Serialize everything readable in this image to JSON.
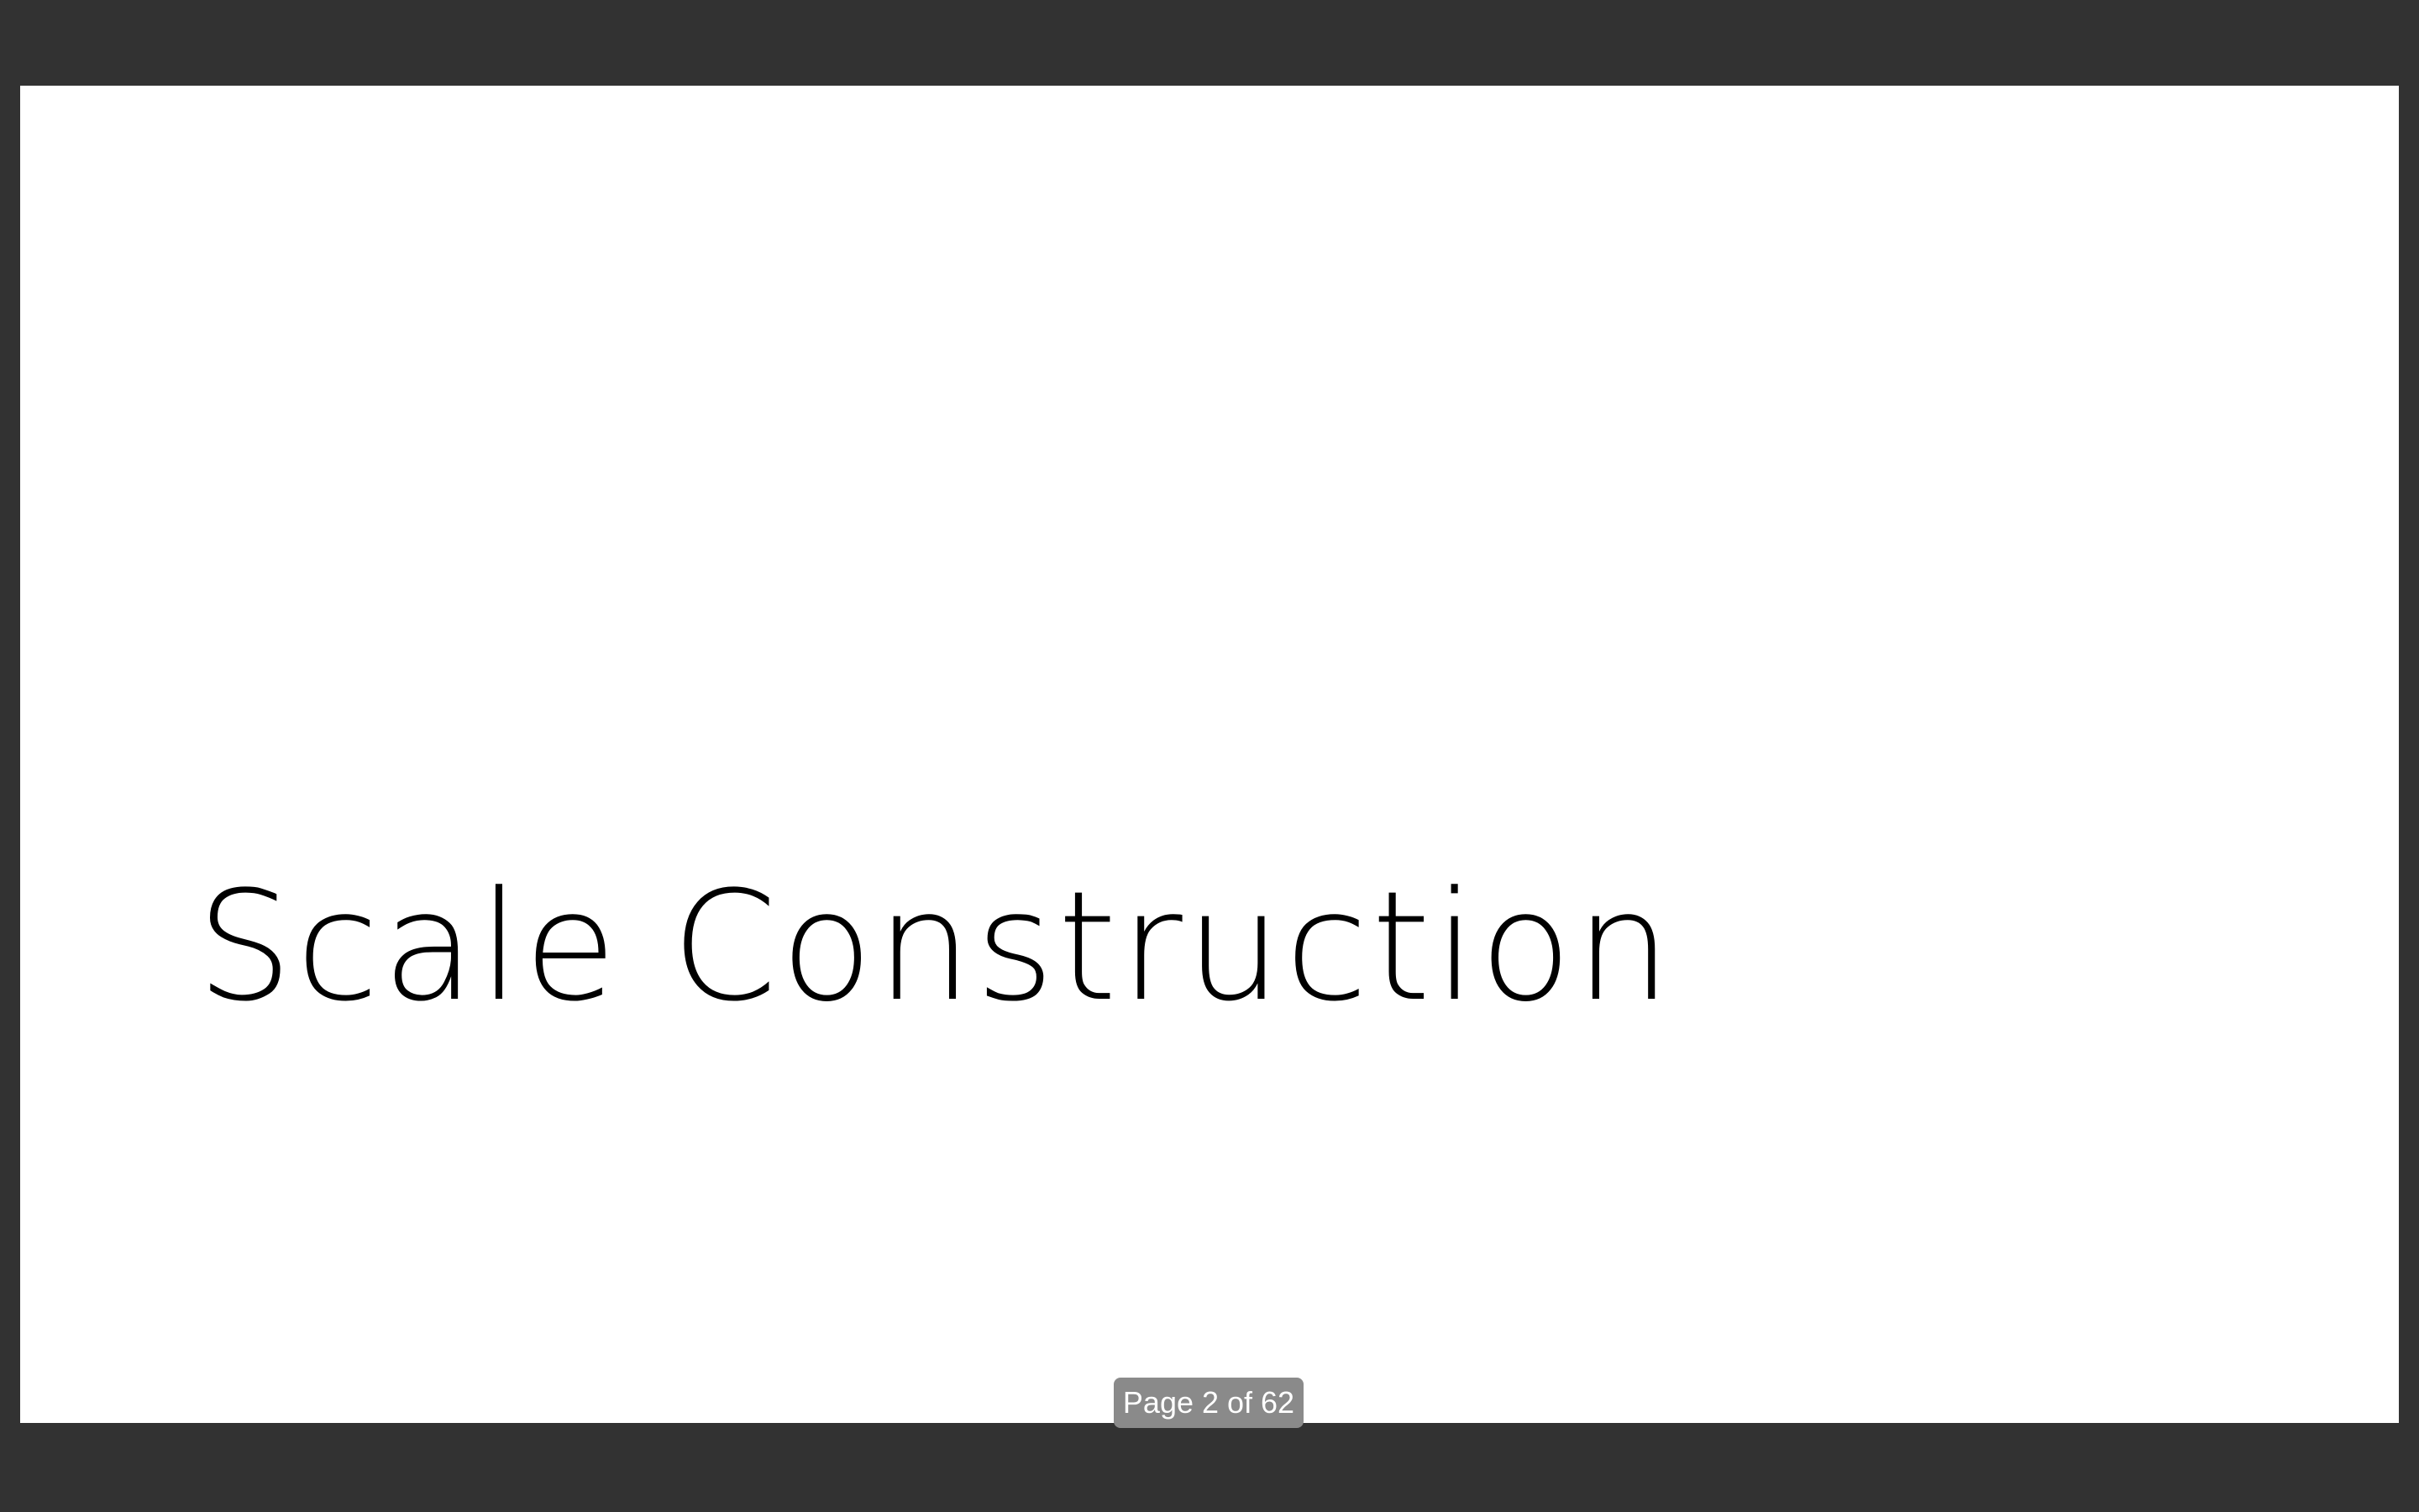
{
  "slide": {
    "title": "Scale Construction"
  },
  "page_indicator": {
    "text": "Page 2 of 62",
    "current_page": 2,
    "total_pages": 62
  },
  "colors": {
    "viewer_background": "#323232",
    "page_background": "#ffffff",
    "title_text": "#000000",
    "indicator_background": "#8a8a8a",
    "indicator_text": "#ffffff"
  }
}
